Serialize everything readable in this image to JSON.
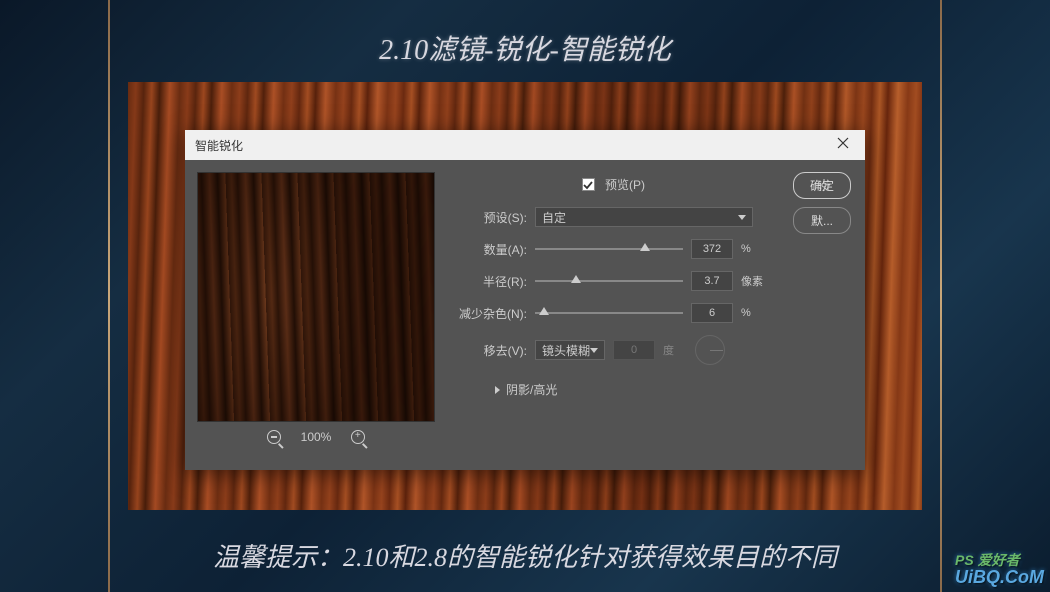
{
  "page": {
    "title": "2.10滤镜-锐化-智能锐化",
    "bottom_tip": "温馨提示：2.10和2.8的智能锐化针对获得效果目的不同"
  },
  "dialog": {
    "title": "智能锐化",
    "preview_label": "预览(P)",
    "ok_label": "确定",
    "default_label": "默...",
    "preset_label": "预设(S):",
    "preset_value": "自定",
    "amount_label": "数量(A):",
    "amount_value": "372",
    "amount_unit": "%",
    "radius_label": "半径(R):",
    "radius_value": "3.7",
    "radius_unit": "像素",
    "noise_label": "减少杂色(N):",
    "noise_value": "6",
    "noise_unit": "%",
    "remove_label": "移去(V):",
    "remove_value": "镜头模糊",
    "angle_value": "0",
    "angle_unit": "度",
    "shadows_label": "阴影/高光",
    "zoom_level": "100%"
  },
  "watermark": {
    "cn": "PS 爱好者",
    "url": "UiBQ.CoM"
  }
}
